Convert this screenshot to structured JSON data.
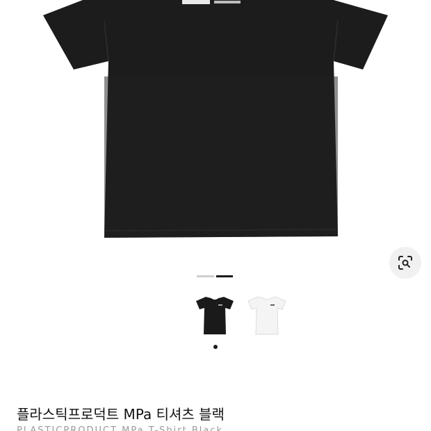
{
  "product": {
    "title": "플라스틱프로덕트 MPa 티셔츠 블랙",
    "subtitle": "PLASTICPRODUCT MPa T-Shirt Black",
    "main_image_icon": "black-tshirt-image",
    "thumbnails": [
      {
        "icon": "black-tshirt-thumbnail",
        "color": "#1a1a1a"
      },
      {
        "icon": "white-tshirt-thumbnail",
        "color": "#f4f4f4"
      }
    ]
  },
  "gallery": {
    "indicator_colors": [
      "#cfcfcf",
      "#1a1a1a"
    ],
    "selected_thumbnail_dot_color": "#1a1a1a"
  },
  "actions": {
    "lens_icon": "image-search-icon"
  },
  "colors": {
    "tshirt_black": "#1c1c1c",
    "background": "#ffffff"
  }
}
